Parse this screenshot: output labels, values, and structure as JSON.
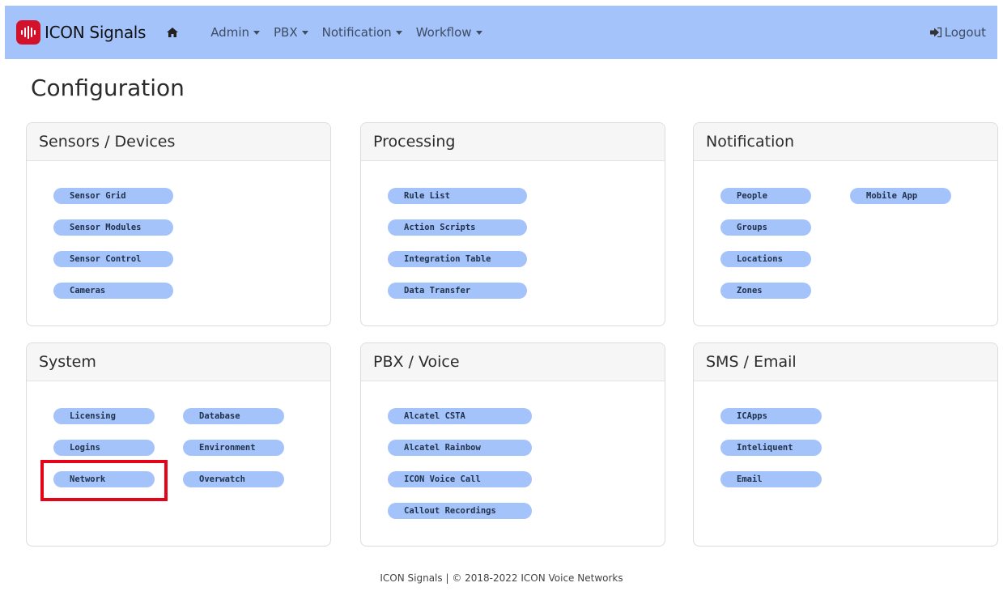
{
  "navbar": {
    "brand": "ICON Signals",
    "items": [
      {
        "label": "Admin"
      },
      {
        "label": "PBX"
      },
      {
        "label": "Notification"
      },
      {
        "label": "Workflow"
      }
    ],
    "logout": "Logout",
    "color": "#a4c3fb",
    "brand_color": "#d1122a"
  },
  "page": {
    "title": "Configuration"
  },
  "panels": {
    "sensors": {
      "title": "Sensors / Devices",
      "buttons": [
        "Sensor Grid",
        "Sensor Modules",
        "Sensor Control",
        "Cameras"
      ]
    },
    "processing": {
      "title": "Processing",
      "buttons": [
        "Rule List",
        "Action Scripts",
        "Integration Table",
        "Data Transfer"
      ]
    },
    "notification": {
      "title": "Notification",
      "buttons": [
        "People",
        "Groups",
        "Locations",
        "Zones",
        "Mobile App"
      ]
    },
    "system": {
      "title": "System",
      "buttons": [
        "Licensing",
        "Logins",
        "Network",
        "Database",
        "Environment",
        "Overwatch"
      ]
    },
    "pbx": {
      "title": "PBX / Voice",
      "buttons": [
        "Alcatel CSTA",
        "Alcatel Rainbow",
        "ICON Voice Call",
        "Callout Recordings"
      ]
    },
    "sms": {
      "title": "SMS / Email",
      "buttons": [
        "ICApps",
        "Inteliquent",
        "Email"
      ]
    }
  },
  "footer": "ICON Signals | © 2018-2022 ICON Voice Networks",
  "colors": {
    "pill": "#a4c3fb",
    "highlight": "#e3061b"
  }
}
